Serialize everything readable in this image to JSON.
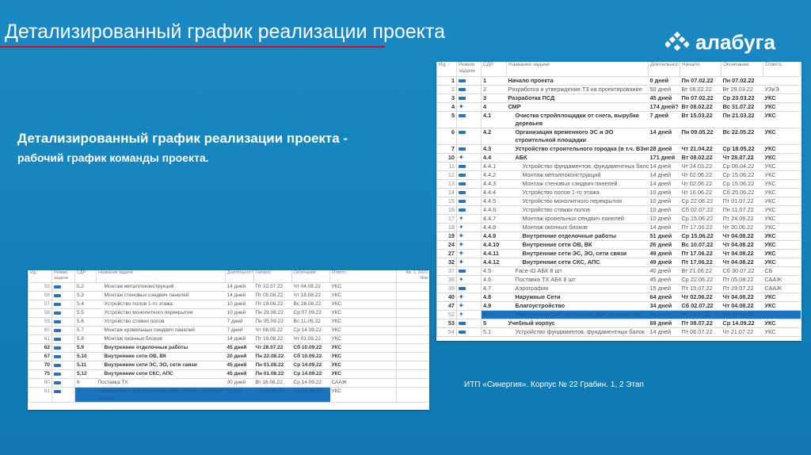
{
  "header": {
    "title": "Детализированный график реализации проекта",
    "logo_text": "алабуга",
    "accent": "#c8102e"
  },
  "subtitle": {
    "line1": "Детализированный график реализации проекта -",
    "line2": "рабочий график команды проекта."
  },
  "caption": "ИТП «Синергия». Корпус № 22 Грабин. 1, 2 Этап",
  "columns": {
    "id": "Ид.",
    "mode": "Режим задачи",
    "wbs": "СДР",
    "name": "Название задачи",
    "dur": "Длительность",
    "start": "Начало",
    "end": "Окончание",
    "resp": "Ответс.",
    "timeline": "Кв. 1, 2022 Янв"
  },
  "right_table": {
    "rows": [
      {
        "id": "1",
        "mode": "auto",
        "wbs": "1",
        "name": "Начало проекта",
        "dur": "0 дней",
        "start": "Пн 07.02.22",
        "end": "Пн 07.02.22",
        "resp": "",
        "bold": true,
        "level": 0
      },
      {
        "id": "2",
        "mode": "auto",
        "wbs": "2",
        "name": "Разработка и утверждение ТЗ на проектирование",
        "dur": "50 дней",
        "start": "Вт 08.02.22",
        "end": "Вт 29.03.22",
        "resp": "УЗиЭ",
        "bold": false,
        "level": 0
      },
      {
        "id": "3",
        "mode": "auto",
        "wbs": "3",
        "name": "Разработка ПСД",
        "dur": "45 дней",
        "start": "Пн 07.02.22",
        "end": "Ср 23.03.22",
        "resp": "УКС",
        "bold": true,
        "level": 0
      },
      {
        "id": "4",
        "mode": "manual",
        "wbs": "4",
        "name": "СМР",
        "dur": "174 дней?",
        "start": "Вт 08.02.22",
        "end": "Вс 31.07.22",
        "resp": "УКС",
        "bold": true,
        "level": 0
      },
      {
        "id": "5",
        "mode": "auto",
        "wbs": "4.1",
        "name": "Очистка стройплощадки от снега, вырубка деревьев",
        "dur": "7 дней",
        "start": "Вт 15.03.22",
        "end": "Пн 21.03.22",
        "resp": "УКС",
        "bold": true,
        "level": 1,
        "wrap": true
      },
      {
        "id": "6",
        "mode": "auto",
        "wbs": "4.2",
        "name": "Организация временного ЭС и ЭО строительной площадки",
        "dur": "14 дней",
        "start": "Пн 09.05.22",
        "end": "Вс 22.05.22",
        "resp": "УКС",
        "bold": true,
        "level": 1,
        "wrap": true
      },
      {
        "id": "7",
        "mode": "auto",
        "wbs": "4.3",
        "name": "Устройство строительного городка (в т.ч. ВЗиС)",
        "dur": "28 дней",
        "start": "Чт 21.04.22",
        "end": "Ср 18.05.22",
        "resp": "УКС",
        "bold": true,
        "level": 1
      },
      {
        "id": "10",
        "mode": "manual",
        "wbs": "4.4",
        "name": "АБК",
        "dur": "171 дней",
        "start": "Вт 08.02.22",
        "end": "Чт 28.07.22",
        "resp": "УКС",
        "bold": true,
        "level": 1
      },
      {
        "id": "11",
        "mode": "auto",
        "wbs": "4.4.1",
        "name": "Устройство фундаментов, фундаментных балок",
        "dur": "14 дней",
        "start": "Чт 24.03.22",
        "end": "Ср 06.04.22",
        "resp": "УКС",
        "bold": false,
        "level": 2
      },
      {
        "id": "12",
        "mode": "auto",
        "wbs": "4.4.2",
        "name": "Монтаж металлоконструкций",
        "dur": "14 дней",
        "start": "Чт 02.06.22",
        "end": "Ср 15.06.22",
        "resp": "УКС",
        "bold": false,
        "level": 2
      },
      {
        "id": "13",
        "mode": "auto",
        "wbs": "4.4.3",
        "name": "Монтаж стеновых сэндвич панелей",
        "dur": "14 дней",
        "start": "Чт 02.06.22",
        "end": "Ср 15.06.22",
        "resp": "УКС",
        "bold": false,
        "level": 2
      },
      {
        "id": "14",
        "mode": "auto",
        "wbs": "4.4.4",
        "name": "Устройство полов 1-го этажа",
        "dur": "10 дней",
        "start": "Чт 16.06.22",
        "end": "Сб 25.06.22",
        "resp": "УКС",
        "bold": false,
        "level": 2
      },
      {
        "id": "15",
        "mode": "auto",
        "wbs": "4.4.5",
        "name": "Устройство монолитного перекрытия",
        "dur": "10 дней",
        "start": "Ср 22.06.22",
        "end": "Пт 01.07.22",
        "resp": "УКС",
        "bold": false,
        "level": 2
      },
      {
        "id": "16",
        "mode": "auto",
        "wbs": "4.4.6",
        "name": "Устройство стяжки полов",
        "dur": "10 дней",
        "start": "Сб 02.07.22",
        "end": "Пн 11.07.22",
        "resp": "УКС",
        "bold": false,
        "level": 2
      },
      {
        "id": "17",
        "mode": "manual",
        "wbs": "4.4.7",
        "name": "Монтаж кровельных сендвич панелей",
        "dur": "10 дней",
        "start": "Ср 15.06.22",
        "end": "Пт 24.06.22",
        "resp": "УКС",
        "bold": false,
        "level": 2
      },
      {
        "id": "18",
        "mode": "manual",
        "wbs": "4.4.8",
        "name": "Монтаж оконных блоков",
        "dur": "14 дней",
        "start": "Пт 17.06.22",
        "end": "Чт 30.06.22",
        "resp": "УКС",
        "bold": false,
        "level": 2
      },
      {
        "id": "19",
        "mode": "manual",
        "wbs": "4.4.9",
        "name": "Внутренние отделочные работы",
        "dur": "51 дней",
        "start": "Ср 15.06.22",
        "end": "Чт 04.08.22",
        "resp": "УКС",
        "bold": true,
        "level": 2
      },
      {
        "id": "24",
        "mode": "manual",
        "wbs": "4.4.10",
        "name": "Внутренние сети ОВ, ВК",
        "dur": "26 дней",
        "start": "Вс 10.07.22",
        "end": "Чт 04.08.22",
        "resp": "УКС",
        "bold": true,
        "level": 2
      },
      {
        "id": "27",
        "mode": "manual",
        "wbs": "4.4.11",
        "name": "Внутренние сети ЭС, ЭО, сети связи",
        "dur": "49 дней",
        "start": "Пт 17.06.22",
        "end": "Чт 04.08.22",
        "resp": "УКС",
        "bold": true,
        "level": 2
      },
      {
        "id": "32",
        "mode": "manual",
        "wbs": "4.4.12",
        "name": "Внутренние сети СКС, АПС",
        "dur": "49 дней",
        "start": "Пт 17.06.22",
        "end": "Чт 04.08.22",
        "resp": "УКС",
        "bold": true,
        "level": 2
      },
      {
        "id": "37",
        "mode": "auto",
        "wbs": "4.5",
        "name": "Face-ID АБК 8 шт",
        "dur": "40 дней",
        "start": "Вт 21.06.22",
        "end": "Сб 30.07.22",
        "resp": "СБ",
        "bold": false,
        "level": 1
      },
      {
        "id": "38",
        "mode": "manual",
        "wbs": "4.6",
        "name": "Поставка ТХ АБК 8 шт",
        "dur": "45 дней",
        "start": "Ср 22.06.22",
        "end": "Пт 05.08.22",
        "resp": "СААЖ",
        "bold": false,
        "level": 1
      },
      {
        "id": "39",
        "mode": "auto",
        "wbs": "4.7",
        "name": "Аэрография",
        "dur": "15 дней",
        "start": "Пт 15.07.22",
        "end": "Пт 29.07.22",
        "resp": "СААЖ",
        "bold": false,
        "level": 1
      },
      {
        "id": "40",
        "mode": "manual",
        "wbs": "4.8",
        "name": "Наружные Сети",
        "dur": "64 дней",
        "start": "Чт 02.06.22",
        "end": "Чт 04.08.22",
        "resp": "УКС",
        "bold": true,
        "level": 1
      },
      {
        "id": "47",
        "mode": "manual",
        "wbs": "4.9",
        "name": "Благоустройство",
        "dur": "34 дней",
        "start": "Сб 02.07.22",
        "end": "Чт 04.08.22",
        "resp": "УКС",
        "bold": true,
        "level": 1
      },
      {
        "id": "52",
        "mode": "manual",
        "wbs": "4.10",
        "name": "Завершение СМР, получение ЗОС из всем АБК",
        "dur": "30 дней",
        "start": "Вт 12.07.22",
        "end": "Ср 10.08.22",
        "resp": "",
        "bold": false,
        "level": 1,
        "selected": true
      },
      {
        "id": "53",
        "mode": "auto",
        "wbs": "5",
        "name": "Учебный корпус",
        "dur": "69 дней",
        "start": "Пт 08.07.22",
        "end": "Ср 14.09.22",
        "resp": "УКС",
        "bold": true,
        "level": 0
      },
      {
        "id": "54",
        "mode": "auto",
        "wbs": "5.1",
        "name": "Устройство фундаментов, фундаментных балок",
        "dur": "14 дней",
        "start": "Пт 08.07.22",
        "end": "Чт 21.07.22",
        "resp": "УКС",
        "bold": false,
        "level": 1
      }
    ]
  },
  "left_table": {
    "rows": [
      {
        "id": "55",
        "mode": "auto",
        "wbs": "5.2",
        "name": "Монтаж металлоконструкций",
        "dur": "14 дней",
        "start": "Пт 22.07.22",
        "end": "Чт 04.08.22",
        "resp": "УКС",
        "bold": false,
        "level": 1
      },
      {
        "id": "56",
        "mode": "auto",
        "wbs": "5.3",
        "name": "Монтаж стеновых сэндвич панелей",
        "dur": "14 дней",
        "start": "Пт 05.08.22",
        "end": "Чт 18.08.22",
        "resp": "УКС",
        "bold": false,
        "level": 1
      },
      {
        "id": "57",
        "mode": "auto",
        "wbs": "5.4",
        "name": "Устройство полов 1-го этажа",
        "dur": "10 дней",
        "start": "Пт 19.08.22",
        "end": "Вс 28.08.22",
        "resp": "УКС",
        "bold": false,
        "level": 1
      },
      {
        "id": "58",
        "mode": "auto",
        "wbs": "5.5",
        "name": "Устройство монолитного перекрытия",
        "dur": "10 дней",
        "start": "Пн 29.08.22",
        "end": "Ср 07.09.22",
        "resp": "УКС",
        "bold": false,
        "level": 1
      },
      {
        "id": "59",
        "mode": "auto",
        "wbs": "5.6",
        "name": "Устройство стяжки полов",
        "dur": "7 дней",
        "start": "Пн 05.09.22",
        "end": "Вс 11.09.22",
        "resp": "УКС",
        "bold": false,
        "level": 1
      },
      {
        "id": "60",
        "mode": "auto",
        "wbs": "5.7",
        "name": "Монтаж кровельных сендвич панелей",
        "dur": "7 дней",
        "start": "Чт 08.09.22",
        "end": "Ср 14.09.22",
        "resp": "УКС",
        "bold": false,
        "level": 1
      },
      {
        "id": "61",
        "mode": "auto",
        "wbs": "5.8",
        "name": "Монтаж оконных блоков",
        "dur": "14 дней",
        "start": "Пт 19.08.22",
        "end": "Чт 01.09.22",
        "resp": "УКС",
        "bold": false,
        "level": 1
      },
      {
        "id": "62",
        "mode": "auto",
        "wbs": "5.9",
        "name": "Внутренние отделочные работы",
        "dur": "45 дней",
        "start": "Чт 28.07.22",
        "end": "Сб 10.09.22",
        "resp": "УКС",
        "bold": true,
        "level": 1
      },
      {
        "id": "67",
        "mode": "auto",
        "wbs": "5.10",
        "name": "Внутренние сети ОВ, ВК",
        "dur": "20 дней",
        "start": "Пн 22.08.22",
        "end": "Сб 10.09.22",
        "resp": "УКС",
        "bold": true,
        "level": 1
      },
      {
        "id": "70",
        "mode": "auto",
        "wbs": "5.11",
        "name": "Внутренние сети ЭС, ЭО, сети связи",
        "dur": "45 дней",
        "start": "Пн 01.08.22",
        "end": "Ср 14.09.22",
        "resp": "УКС",
        "bold": true,
        "level": 1
      },
      {
        "id": "75",
        "mode": "auto",
        "wbs": "5.12",
        "name": "Внутренние сети СКС, АПС",
        "dur": "45 дней",
        "start": "Пн 01.08.22",
        "end": "Ср 14.09.22",
        "resp": "УКС",
        "bold": true,
        "level": 1
      },
      {
        "id": "80",
        "mode": "auto",
        "wbs": "6",
        "name": "Поставка ТХ",
        "dur": "30 дней",
        "start": "Вт 16.08.22",
        "end": "Ср 14.09.22",
        "resp": "СААЖ",
        "bold": false,
        "level": 0
      },
      {
        "id": "81",
        "mode": "auto",
        "wbs": "7",
        "name": "Завершение СМР, получение ЗОС объекта Учебный корпус",
        "dur": "0 дней",
        "start": "Ср 14.09.22",
        "end": "Ср 14.09.22",
        "resp": "УКС",
        "bold": false,
        "level": 0,
        "selected": true,
        "wrap": true
      }
    ]
  }
}
